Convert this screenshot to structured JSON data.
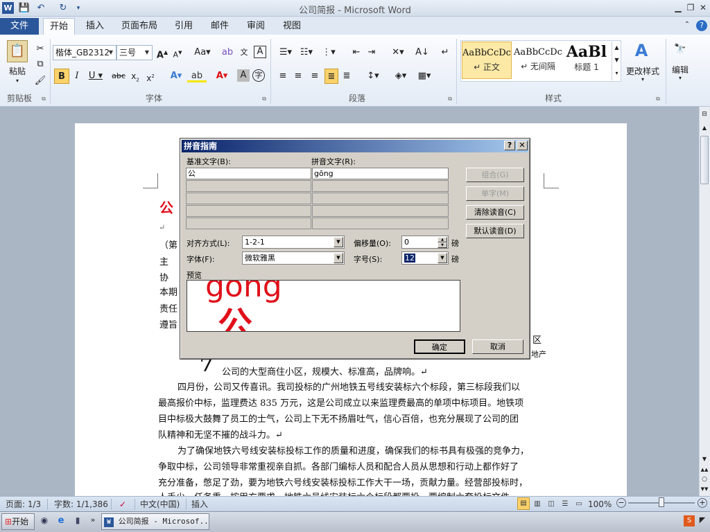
{
  "window": {
    "title": "公司简报 - Microsoft Word"
  },
  "quick_access": {
    "save_icon": "save-icon",
    "undo_icon": "undo-icon",
    "redo_icon": "redo-icon"
  },
  "tabs": [
    {
      "label": "文件"
    },
    {
      "label": "开始"
    },
    {
      "label": "插入"
    },
    {
      "label": "页面布局"
    },
    {
      "label": "引用"
    },
    {
      "label": "邮件"
    },
    {
      "label": "审阅"
    },
    {
      "label": "视图"
    }
  ],
  "ribbon": {
    "clipboard": {
      "paste_label": "粘贴",
      "group_label": "剪贴板"
    },
    "font": {
      "font_name": "楷体_GB2312",
      "font_size": "三号",
      "group_label": "字体"
    },
    "paragraph": {
      "group_label": "段落"
    },
    "styles": {
      "group_label": "样式",
      "items": [
        {
          "preview": "AaBbCcDc",
          "name": "↵ 正文"
        },
        {
          "preview": "AaBbCcDc",
          "name": "↵ 无间隔"
        },
        {
          "preview": "AaBl",
          "name": "标题 1"
        }
      ],
      "change_styles_label": "更改样式"
    },
    "editing": {
      "label": "编辑"
    }
  },
  "document": {
    "left_fragments": [
      "公",
      "（第",
      "主",
      "协",
      "本期",
      "责任",
      "遵旨"
    ],
    "right_fragments": [
      "区",
      "地产"
    ],
    "line_indent": "公司的大型商住小区，规模大、标准高，品牌响。↵",
    "para1": [
      "四月份，公司又传喜讯。我司投标的广州地铁五号线安装标六个标段，第三标段我们以",
      "最高报价中标，监理费达 835 万元，这是公司成立以来监理费最高的单项中标项目。地铁项",
      "目中标极大鼓舞了员工的士气，公司上下无不扬眉吐气，信心百倍，也充分展现了公司的团",
      "队精神和无坚不摧的战斗力。↵"
    ],
    "para2": [
      "为了确保地铁六号线安装标投标工作的质量和进度，确保我们的标书具有极强的竞争力，",
      "争取中标，公司领导非常重视亲自抓。各部门编标人员和配合人员从思想和行动上都作好了",
      "充分准备，憋足了劲，要为地铁六号线安装标投标工作大干一场，贡献力量。经营部投标时，",
      "人手少，任务重，按甲方要求，地铁六号线安装标六个标段都要投，要编制六套投标文件"
    ]
  },
  "dialog": {
    "title": "拼音指南",
    "base_text_label": "基准文字(B):",
    "ruby_text_label": "拼音文字(R):",
    "rows": [
      {
        "base": "公",
        "ruby": "gōng"
      },
      {
        "base": "",
        "ruby": ""
      },
      {
        "base": "",
        "ruby": ""
      },
      {
        "base": "",
        "ruby": ""
      },
      {
        "base": "",
        "ruby": ""
      }
    ],
    "buttons": {
      "group": "组合(G)",
      "mono": "单字(M)",
      "clear": "清除读音(C)",
      "default": "默认读音(D)",
      "ok": "确定",
      "cancel": "取消"
    },
    "alignment_label": "对齐方式(L):",
    "alignment_value": "1-2-1",
    "offset_label": "偏移量(O):",
    "offset_value": "0",
    "offset_unit": "磅",
    "font_label": "字体(F):",
    "font_value": "微软雅黑",
    "size_label": "字号(S):",
    "size_value": "12",
    "size_unit": "磅",
    "preview_label": "预览",
    "preview_ruby": "gong",
    "preview_base": "公",
    "help_glyph": "?",
    "close_glyph": "✕"
  },
  "status": {
    "page": "页面: 1/3",
    "words": "字数: 1/1,386",
    "language": "中文(中国)",
    "mode": "插入",
    "zoom": "100%",
    "zoom_level": 1.0
  },
  "taskbar": {
    "start": "开始",
    "task": "公司简报 - Microsof..."
  },
  "colors": {
    "accent": "#2b579a",
    "dialog_title": "#0a246a",
    "preview_red": "#e0101a"
  }
}
